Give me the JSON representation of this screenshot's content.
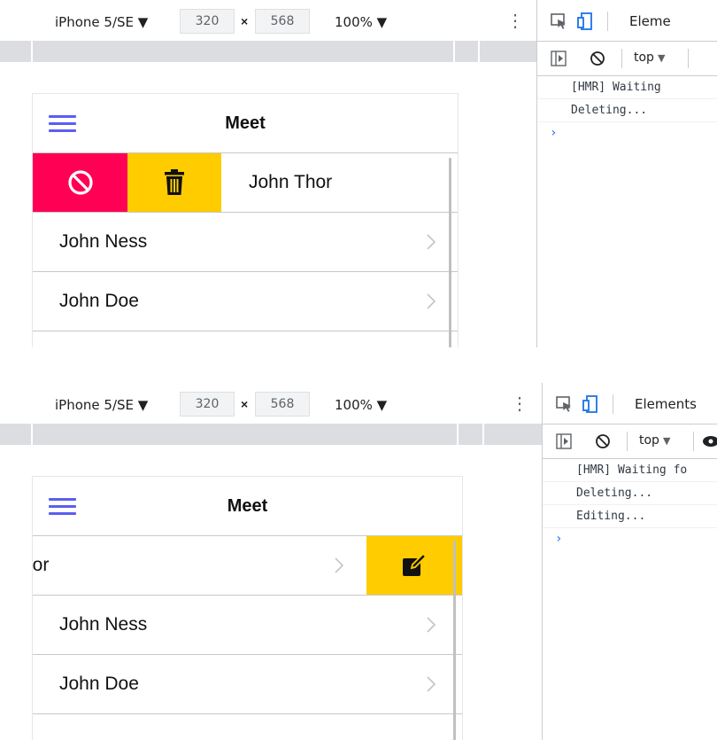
{
  "device_toolbar": {
    "device": "iPhone 5/SE ▼",
    "width": "320",
    "times": "×",
    "height": "568",
    "zoom": "100% ▼",
    "more_icon": "kebab-icon"
  },
  "colors": {
    "block_action": "#ff0055",
    "trash_action": "#ffcc00",
    "edit_action": "#ffcc00",
    "menu_icon": "#5b5ef0",
    "console_prompt": "#1a73e8"
  },
  "panel1": {
    "devtools_tab": "Eleme",
    "context": "top",
    "console_lines": [
      "[HMR] Waiting",
      "Deleting..."
    ],
    "prompt": "›",
    "app_title": "Meet",
    "rows": [
      {
        "name": "John Thor"
      },
      {
        "name": "John Ness"
      },
      {
        "name": "John Doe"
      }
    ]
  },
  "panel2": {
    "devtools_tab": "Elements",
    "context": "top",
    "console_lines": [
      "[HMR] Waiting fo",
      "Deleting...",
      "Editing..."
    ],
    "prompt": "›",
    "app_title": "Meet",
    "rows": [
      {
        "name": "hor"
      },
      {
        "name": "John Ness"
      },
      {
        "name": "John Doe"
      }
    ]
  }
}
